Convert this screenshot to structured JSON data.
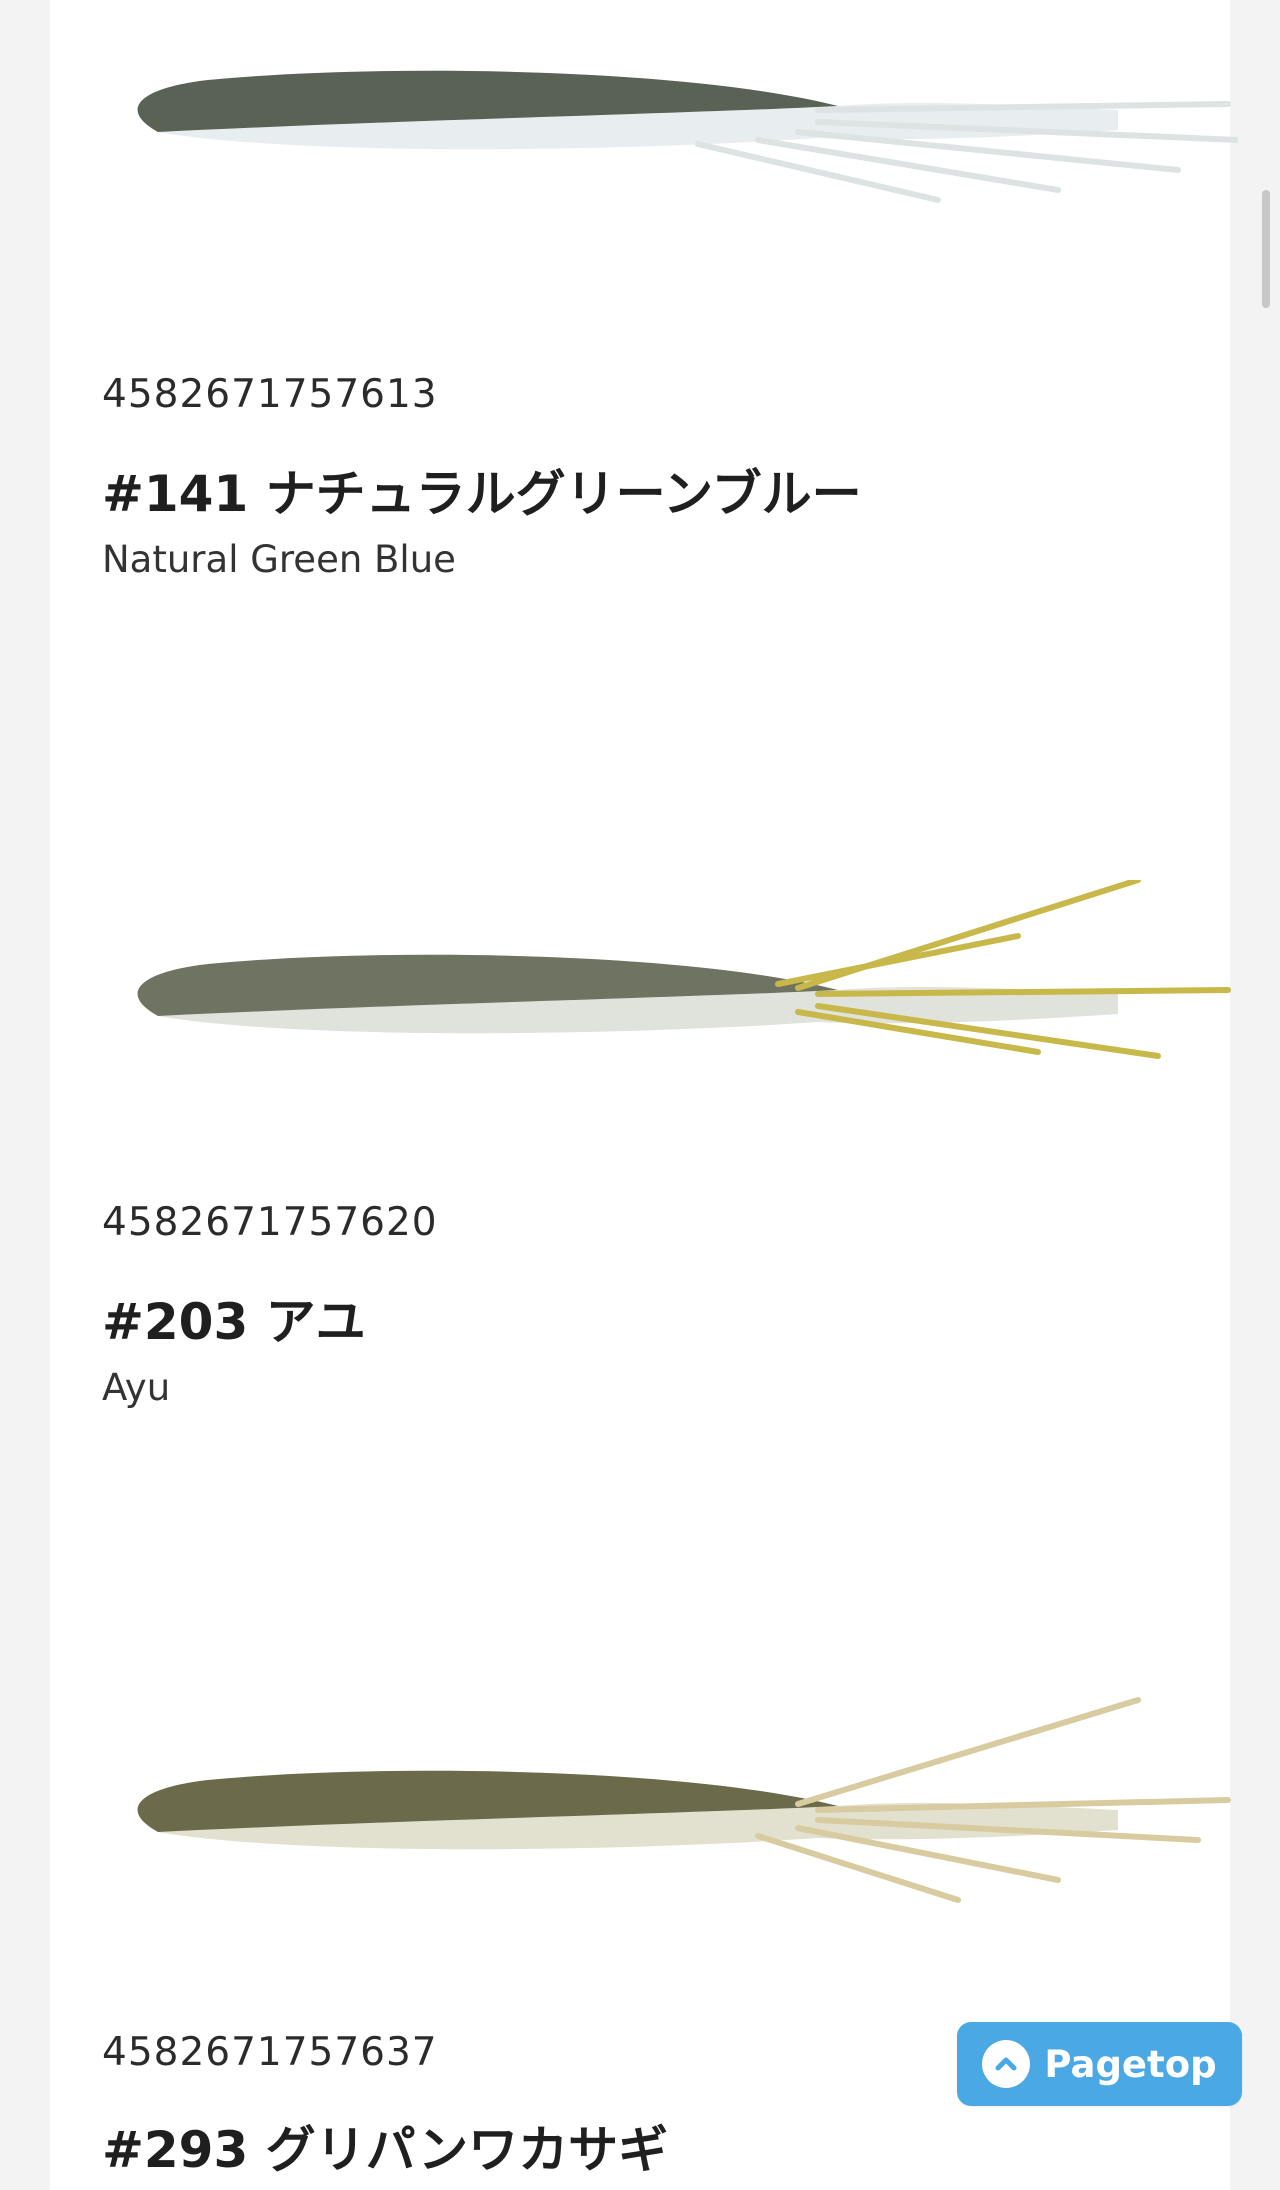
{
  "products": [
    {
      "jan": "4582671757613",
      "name": "#141 ナチュラルグリーンブルー",
      "name_en": "Natural Green Blue",
      "image_icon": "lure-natural-green-blue",
      "colors": {
        "back": "#5a6256",
        "belly": "#e8eef0",
        "tail": "#e9ecec"
      }
    },
    {
      "jan": "4582671757620",
      "name": "#203 アユ",
      "name_en": "Ayu",
      "image_icon": "lure-ayu",
      "colors": {
        "back": "#6e7461",
        "belly": "#dfe3dc",
        "tail": "#c8b84a"
      }
    },
    {
      "jan": "4582671757637",
      "name": "#293 グリパンワカサギ",
      "name_en": "",
      "image_icon": "lure-green-pumpkin-wakasagi",
      "colors": {
        "back": "#6b6a4a",
        "belly": "#e2e0cf",
        "tail": "#d8cba0"
      }
    }
  ],
  "pagetop": {
    "label": "Pagetop",
    "icon": "chevron-up-circle-icon",
    "color": "#4aa8e4"
  }
}
